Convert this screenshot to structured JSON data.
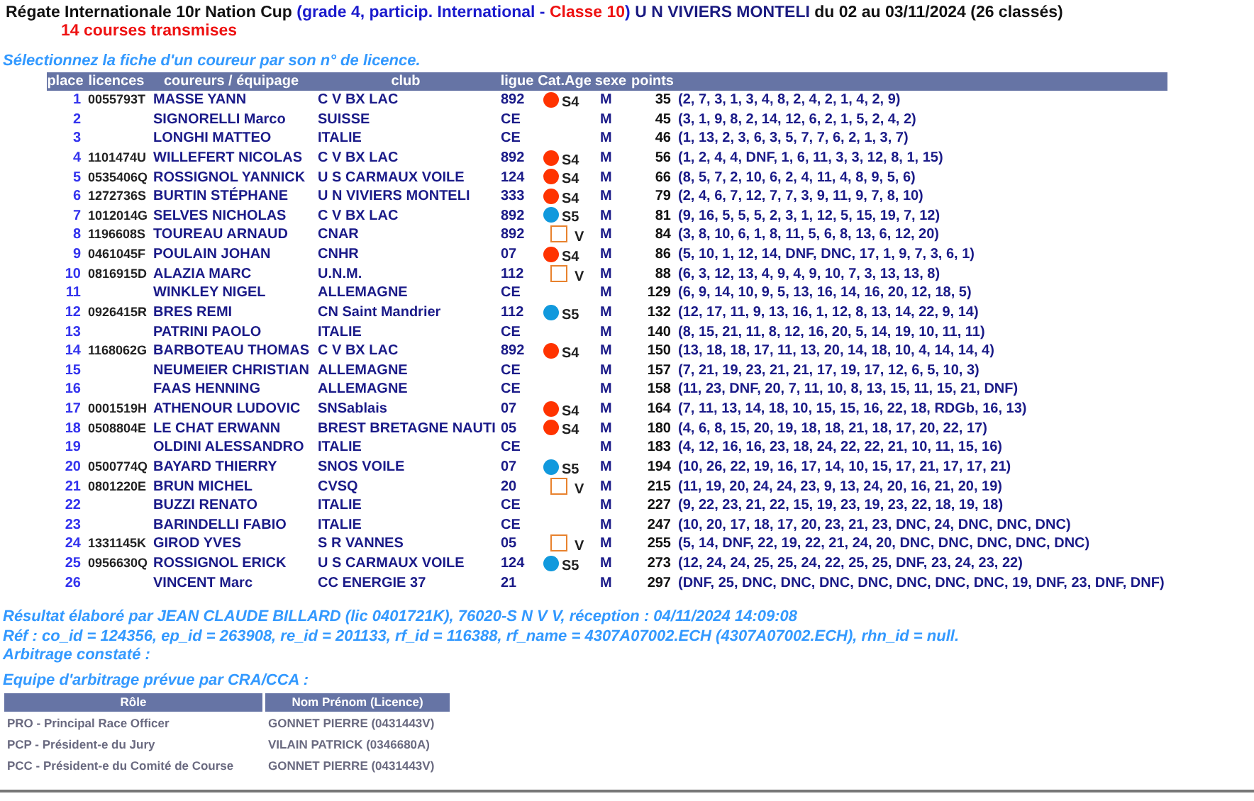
{
  "title": {
    "parts": [
      {
        "text": "Régate Internationale 10r Nation Cup",
        "color": "#111111",
        "glue": false
      },
      {
        "text": "(grade 4, particip. International -",
        "color": "#1a1acc",
        "glue": false
      },
      {
        "text": "Classe 10",
        "color": "#ee1111",
        "glue": false
      },
      {
        "text": ")",
        "color": "#1a1acc",
        "glue": true
      },
      {
        "text": "U N VIVIERS MONTELI",
        "color": "#1a1a80",
        "glue": false
      },
      {
        "text": "du 02 au 03/11/2024 (26 classés)",
        "color": "#111111",
        "glue": false
      }
    ],
    "subtitle": "14 courses transmises"
  },
  "instruction": "Sélectionnez la fiche d'un coureur par son n° de licence.",
  "table": {
    "columns": [
      "place",
      "licences",
      "coureurs / équipage",
      "club",
      "ligue",
      "Cat.Age",
      "sexe",
      "points"
    ],
    "rows": [
      {
        "place": "1",
        "licence": "0055793T",
        "name": "MASSE YANN",
        "club": "C V BX LAC",
        "ligue": "892",
        "category": {
          "label": "S4",
          "kind": "dot",
          "color": "#ff3300"
        },
        "sexe": "M",
        "points": "35",
        "results": "(2, 7, 3, 1, 3, 4, 8, 2, 4, 2, 1, 4, 2, 9)"
      },
      {
        "place": "2",
        "name": "SIGNORELLI Marco",
        "club": "SUISSE",
        "ligue": "CE",
        "sexe": "M",
        "points": "45",
        "results": "(3, 1, 9, 8, 2, 14, 12, 6, 2, 1, 5, 2, 4, 2)"
      },
      {
        "place": "3",
        "name": "LONGHI MATTEO",
        "club": "ITALIE",
        "ligue": "CE",
        "sexe": "M",
        "points": "46",
        "results": "(1, 13, 2, 3, 6, 3, 5, 7, 7, 6, 2, 1, 3, 7)"
      },
      {
        "place": "4",
        "licence": "1101474U",
        "name": "WILLEFERT NICOLAS",
        "club": "C V BX LAC",
        "ligue": "892",
        "category": {
          "label": "S4",
          "kind": "dot",
          "color": "#ff3300"
        },
        "sexe": "M",
        "points": "56",
        "results": "(1, 2, 4, 4, DNF, 1, 6, 11, 3, 3, 12, 8, 1, 15)"
      },
      {
        "place": "5",
        "licence": "0535406Q",
        "name": "ROSSIGNOL YANNICK",
        "club": "U S CARMAUX VOILE",
        "ligue": "124",
        "category": {
          "label": "S4",
          "kind": "dot",
          "color": "#ff3300"
        },
        "sexe": "M",
        "points": "66",
        "results": "(8, 5, 7, 2, 10, 6, 2, 4, 11, 4, 8, 9, 5, 6)"
      },
      {
        "place": "6",
        "licence": "1272736S",
        "name": "BURTIN STÉPHANE",
        "club": "U N VIVIERS MONTELI",
        "ligue": "333",
        "category": {
          "label": "S4",
          "kind": "dot",
          "color": "#ff3300"
        },
        "sexe": "M",
        "points": "79",
        "results": "(2, 4, 6, 7, 12, 7, 7, 3, 9, 11, 9, 7, 8, 10)"
      },
      {
        "place": "7",
        "licence": "1012014G",
        "name": "SELVES NICHOLAS",
        "club": "C V BX LAC",
        "ligue": "892",
        "category": {
          "label": "S5",
          "kind": "dot",
          "color": "#1199dd"
        },
        "sexe": "M",
        "points": "81",
        "results": "(9, 16, 5, 5, 5, 2, 3, 1, 12, 5, 15, 19, 7, 12)"
      },
      {
        "place": "8",
        "licence": "1196608S",
        "name": "TOUREAU ARNAUD",
        "club": "CNAR",
        "ligue": "892",
        "category": {
          "label": "V",
          "kind": "square",
          "color": "#e8822e"
        },
        "sexe": "M",
        "points": "84",
        "results": "(3, 8, 10, 6, 1, 8, 11, 5, 6, 8, 13, 6, 12, 20)"
      },
      {
        "place": "9",
        "licence": "0461045F",
        "name": "POULAIN JOHAN",
        "club": "CNHR",
        "ligue": "07",
        "category": {
          "label": "S4",
          "kind": "dot",
          "color": "#ff3300"
        },
        "sexe": "M",
        "points": "86",
        "results": "(5, 10, 1, 12, 14, DNF, DNC, 17, 1, 9, 7, 3, 6, 1)"
      },
      {
        "place": "10",
        "licence": "0816915D",
        "name": "ALAZIA MARC",
        "club": "U.N.M.",
        "ligue": "112",
        "category": {
          "label": "V",
          "kind": "square",
          "color": "#e8822e"
        },
        "sexe": "M",
        "points": "88",
        "results": "(6, 3, 12, 13, 4, 9, 4, 9, 10, 7, 3, 13, 13, 8)"
      },
      {
        "place": "11",
        "name": "WINKLEY NIGEL",
        "club": "ALLEMAGNE",
        "ligue": "CE",
        "sexe": "M",
        "points": "129",
        "results": "(6, 9, 14, 10, 9, 5, 13, 16, 14, 16, 20, 12, 18, 5)"
      },
      {
        "place": "12",
        "licence": "0926415R",
        "name": "BRES REMI",
        "club": "CN Saint Mandrier",
        "ligue": "112",
        "category": {
          "label": "S5",
          "kind": "dot",
          "color": "#1199dd"
        },
        "sexe": "M",
        "points": "132",
        "results": "(12, 17, 11, 9, 13, 16, 1, 12, 8, 13, 14, 22, 9, 14)"
      },
      {
        "place": "13",
        "name": "PATRINI PAOLO",
        "club": "ITALIE",
        "ligue": "CE",
        "sexe": "M",
        "points": "140",
        "results": "(8, 15, 21, 11, 8, 12, 16, 20, 5, 14, 19, 10, 11, 11)"
      },
      {
        "place": "14",
        "licence": "1168062G",
        "name": "BARBOTEAU THOMAS",
        "club": "C V BX LAC",
        "ligue": "892",
        "category": {
          "label": "S4",
          "kind": "dot",
          "color": "#ff3300"
        },
        "sexe": "M",
        "points": "150",
        "results": "(13, 18, 18, 17, 11, 13, 20, 14, 18, 10, 4, 14, 14, 4)"
      },
      {
        "place": "15",
        "name": "NEUMEIER CHRISTIAN",
        "club": "ALLEMAGNE",
        "ligue": "CE",
        "sexe": "M",
        "points": "157",
        "results": "(7, 21, 19, 23, 21, 21, 17, 19, 17, 12, 6, 5, 10, 3)"
      },
      {
        "place": "16",
        "name": "FAAS HENNING",
        "club": "ALLEMAGNE",
        "ligue": "CE",
        "sexe": "M",
        "points": "158",
        "results": "(11, 23, DNF, 20, 7, 11, 10, 8, 13, 15, 11, 15, 21, DNF)"
      },
      {
        "place": "17",
        "licence": "0001519H",
        "name": "ATHENOUR LUDOVIC",
        "club": "SNSablais",
        "ligue": "07",
        "category": {
          "label": "S4",
          "kind": "dot",
          "color": "#ff3300"
        },
        "sexe": "M",
        "points": "164",
        "results": "(7, 11, 13, 14, 18, 10, 15, 15, 16, 22, 18, RDGb, 16, 13)"
      },
      {
        "place": "18",
        "licence": "0508804E",
        "name": "LE CHAT ERWANN",
        "club": "BREST BRETAGNE NAUTI",
        "ligue": "05",
        "category": {
          "label": "S4",
          "kind": "dot",
          "color": "#ff3300"
        },
        "sexe": "M",
        "points": "180",
        "results": "(4, 6, 8, 15, 20, 19, 18, 18, 21, 18, 17, 20, 22, 17)"
      },
      {
        "place": "19",
        "name": "OLDINI ALESSANDRO",
        "club": "ITALIE",
        "ligue": "CE",
        "sexe": "M",
        "points": "183",
        "results": "(4, 12, 16, 16, 23, 18, 24, 22, 22, 21, 10, 11, 15, 16)"
      },
      {
        "place": "20",
        "licence": "0500774Q",
        "name": "BAYARD THIERRY",
        "club": "SNOS VOILE",
        "ligue": "07",
        "category": {
          "label": "S5",
          "kind": "dot",
          "color": "#1199dd"
        },
        "sexe": "M",
        "points": "194",
        "results": "(10, 26, 22, 19, 16, 17, 14, 10, 15, 17, 21, 17, 17, 21)"
      },
      {
        "place": "21",
        "licence": "0801220E",
        "name": "BRUN MICHEL",
        "club": "CVSQ",
        "ligue": "20",
        "category": {
          "label": "V",
          "kind": "square",
          "color": "#e8822e"
        },
        "sexe": "M",
        "points": "215",
        "results": "(11, 19, 20, 24, 24, 23, 9, 13, 24, 20, 16, 21, 20, 19)"
      },
      {
        "place": "22",
        "name": "BUZZI RENATO",
        "club": "ITALIE",
        "ligue": "CE",
        "sexe": "M",
        "points": "227",
        "results": "(9, 22, 23, 21, 22, 15, 19, 23, 19, 23, 22, 18, 19, 18)"
      },
      {
        "place": "23",
        "name": "BARINDELLI FABIO",
        "club": "ITALIE",
        "ligue": "CE",
        "sexe": "M",
        "points": "247",
        "results": "(10, 20, 17, 18, 17, 20, 23, 21, 23, DNC, 24, DNC, DNC, DNC)"
      },
      {
        "place": "24",
        "licence": "1331145K",
        "name": "GIROD YVES",
        "club": "S R VANNES",
        "ligue": "05",
        "category": {
          "label": "V",
          "kind": "square",
          "color": "#e8822e"
        },
        "sexe": "M",
        "points": "255",
        "results": "(5, 14, DNF, 22, 19, 22, 21, 24, 20, DNC, DNC, DNC, DNC, DNC)"
      },
      {
        "place": "25",
        "licence": "0956630Q",
        "name": "ROSSIGNOL ERICK",
        "club": "U S CARMAUX VOILE",
        "ligue": "124",
        "category": {
          "label": "S5",
          "kind": "dot",
          "color": "#1199dd"
        },
        "sexe": "M",
        "points": "273",
        "results": "(12, 24, 24, 25, 25, 24, 22, 25, 25, DNF, 23, 24, 23, 22)"
      },
      {
        "place": "26",
        "name": "VINCENT Marc",
        "club": "CC ENERGIE 37",
        "ligue": "21",
        "sexe": "M",
        "points": "297",
        "results": "(DNF, 25, DNC, DNC, DNC, DNC, DNC, DNC, DNC, 19, DNF, 23, DNF, DNF)"
      }
    ]
  },
  "footer": {
    "lines": [
      "Résultat élaboré par JEAN CLAUDE BILLARD (lic 0401721K), 76020-S N V V, réception : 04/11/2024 14:09:08",
      "Réf : co_id = 124356, ep_id = 263908, re_id = 201133, rf_id = 116388, rf_name = 4307A07002.ECH (4307A07002.ECH), rhn_id = null.",
      "Arbitrage constaté :"
    ],
    "team_heading": "Equipe d'arbitrage prévue par CRA/CCA :"
  },
  "arbitrage": {
    "columns": [
      "Rôle",
      "Nom Prénom (Licence)"
    ],
    "rows": [
      [
        "PRO - Principal Race Officer",
        "GONNET PIERRE (0431443V)"
      ],
      [
        "PCP - Président-e du Jury",
        "VILAIN PATRICK (0346680A)"
      ],
      [
        "PCC - Président-e du Comité de Course",
        "GONNET PIERRE (0431443V)"
      ]
    ]
  }
}
